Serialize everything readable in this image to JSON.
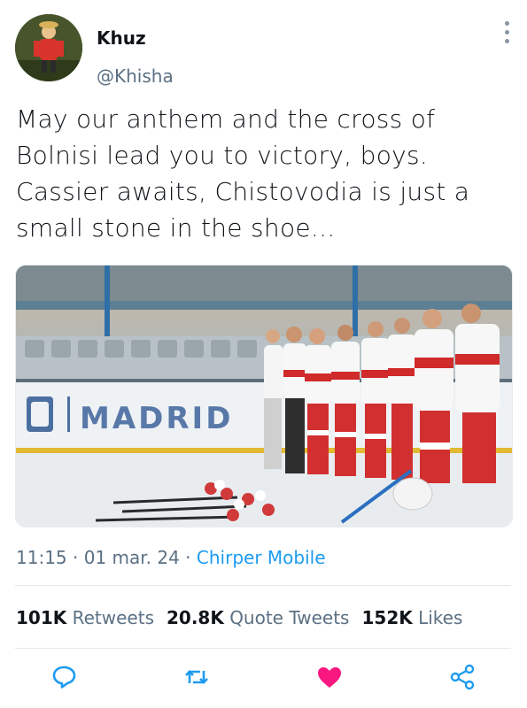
{
  "author": {
    "name": "Khuz",
    "handle": "@Khisha",
    "avatar_icon": "cartoon-figure-avatar"
  },
  "tweet": {
    "text": "May our anthem and the cross of Bolnisi lead you to victory, boys. Cassier awaits, Chistovodia is just a small stone in the shoe..."
  },
  "media": {
    "rink_banner_text": "MADRID",
    "description_icon": "hockey-team-photo"
  },
  "meta": {
    "time": "11:15",
    "separator": " · ",
    "date": "01 mar. 24",
    "source": "Chirper Mobile"
  },
  "stats": {
    "retweets_count": "101K",
    "retweets_label": "Retweets",
    "quotes_count": "20.8K",
    "quotes_label": "Quote Tweets",
    "likes_count": "152K",
    "likes_label": "Likes"
  },
  "actions": {
    "reply_icon": "reply-icon",
    "retweet_icon": "retweet-icon",
    "like_icon": "heart-icon",
    "share_icon": "share-icon",
    "liked": true
  },
  "colors": {
    "accent": "#1d9bf0",
    "like": "#f91880",
    "secondary_text": "#5b7083"
  }
}
